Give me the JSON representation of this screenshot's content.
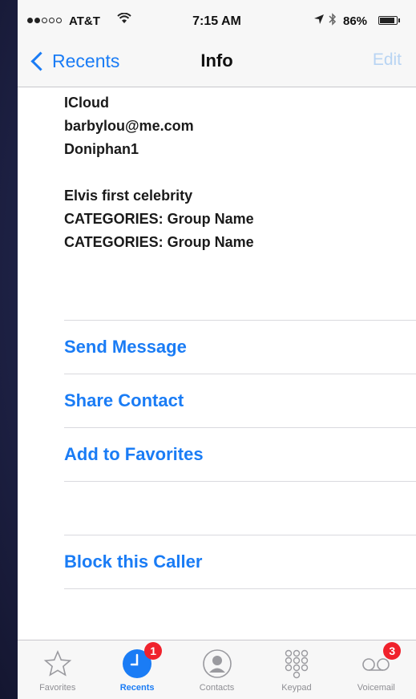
{
  "status_bar": {
    "carrier": "AT&T",
    "time": "7:15 AM",
    "battery": "86%",
    "battery_level": 0.86,
    "signal_bars_filled": 2,
    "signal_bars_total": 5,
    "icons": [
      "wifi-icon",
      "location-icon",
      "bluetooth-icon",
      "battery-icon"
    ]
  },
  "nav": {
    "back_label": "Recents",
    "title": "Info",
    "edit_label": "Edit"
  },
  "notes": {
    "block1": [
      "ICloud",
      "barbylou@me.com",
      "Doniphan1"
    ],
    "block2": [
      "Elvis first celebrity",
      "CATEGORIES: Group Name",
      "CATEGORIES: Group Name"
    ]
  },
  "actions": {
    "send_message": "Send Message",
    "share_contact": "Share Contact",
    "add_to_favorites": "Add to Favorites",
    "block_caller": "Block this Caller"
  },
  "tab_bar": {
    "tabs": [
      {
        "label": "Favorites",
        "icon": "star-icon",
        "active": false
      },
      {
        "label": "Recents",
        "icon": "clock-icon",
        "active": true,
        "badge": "1"
      },
      {
        "label": "Contacts",
        "icon": "person-icon",
        "active": false
      },
      {
        "label": "Keypad",
        "icon": "keypad-icon",
        "active": false
      },
      {
        "label": "Voicemail",
        "icon": "voicemail-icon",
        "active": false,
        "badge": "3"
      }
    ]
  },
  "colors": {
    "accent": "#1a7cf5",
    "badge": "#f0222c",
    "disabled": "#b8d4f3"
  }
}
